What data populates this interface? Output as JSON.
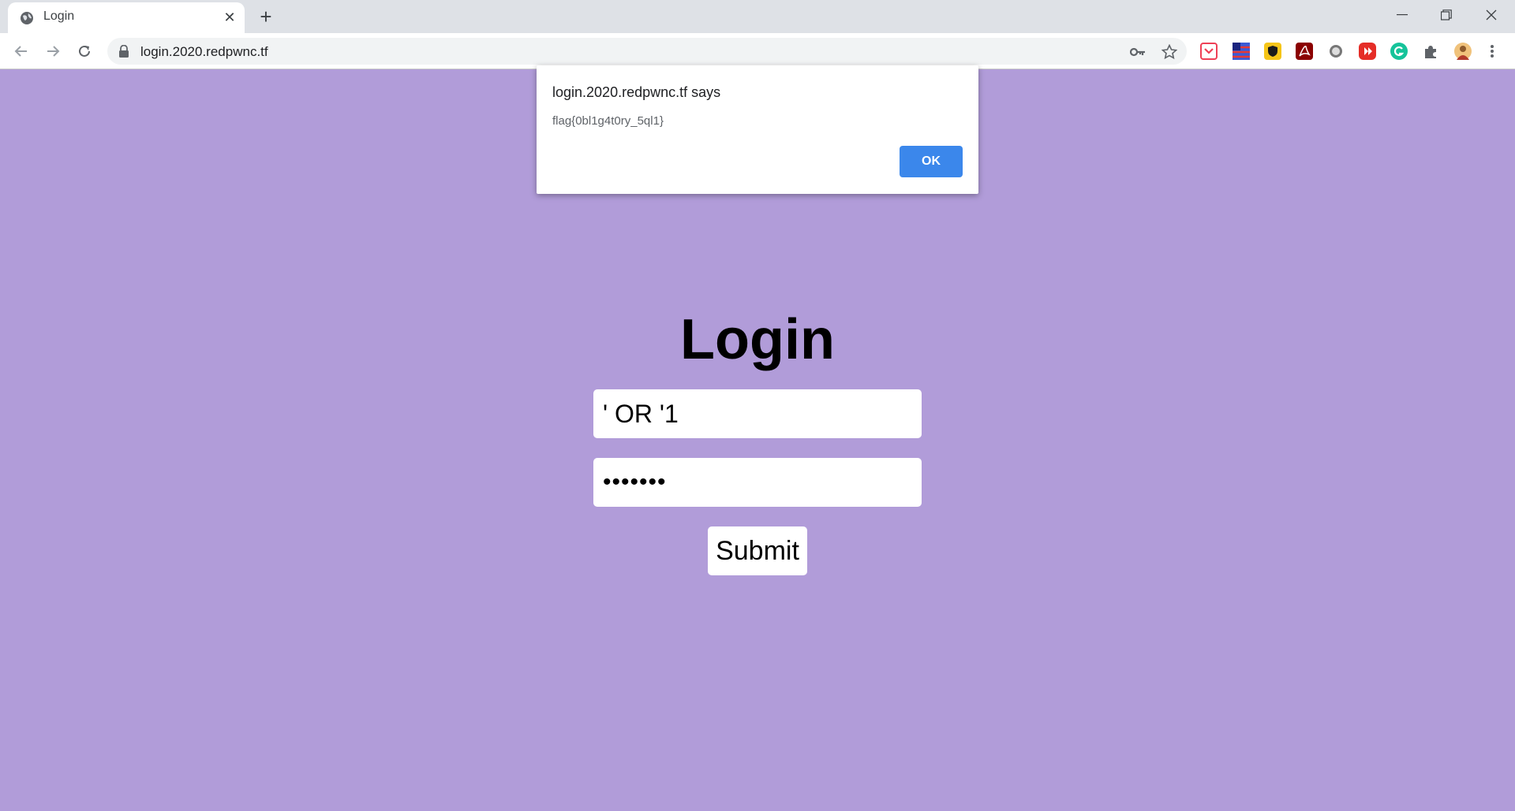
{
  "browser": {
    "tab_title": "Login",
    "tab_close": "✕",
    "new_tab": "+",
    "url": "login.2020.redpwnc.tf",
    "window": {
      "minimize": "—",
      "restore": "❐",
      "close": "✕"
    }
  },
  "page": {
    "title": "Login",
    "username_value": "' OR '1",
    "password_value": "•••••••",
    "submit_label": "Submit",
    "background": "#b19cd9"
  },
  "alert": {
    "title": "login.2020.redpwnc.tf says",
    "message": "flag{0bl1g4t0ry_5ql1}",
    "ok_label": "OK"
  },
  "extensions": [
    "pocket-icon",
    "flag-icon",
    "shield-icon",
    "pdf-icon",
    "circle-icon",
    "youtube-icon",
    "grammarly-icon",
    "puzzle-icon",
    "avatar"
  ]
}
